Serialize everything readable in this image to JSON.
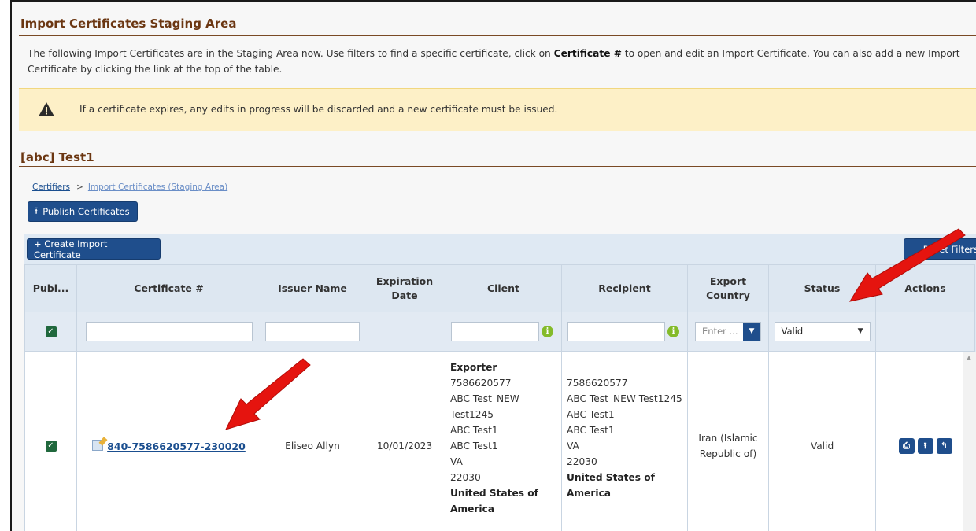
{
  "page": {
    "title": "Import Certificates Staging Area",
    "intro_part1": "The following Import Certificates are in the Staging Area now. Use filters to find a specific certificate, click on ",
    "intro_bold": "Certificate #",
    "intro_part2": " to open and edit an Import Certificate. You can also add a new Import Certificate by clicking the link at the top of the table.",
    "alert": "If a certificate expires, any edits in progress will be discarded and a new certificate must be issued.",
    "section_title": "[abc] Test1"
  },
  "breadcrumb": {
    "root": "Certifiers",
    "separator": ">",
    "current": "Import Certificates (Staging Area)"
  },
  "toolbar": {
    "publish_label": "Publish Certificates",
    "create_label": "+ Create Import Certificate",
    "reset_label": "Reset Filters"
  },
  "table": {
    "headers": {
      "published": "Publ...",
      "certificate": "Certificate #",
      "issuer": "Issuer Name",
      "expiration": "Expiration Date",
      "client": "Client",
      "recipient": "Recipient",
      "export_country": "Export Country",
      "status": "Status",
      "actions": "Actions"
    },
    "filters": {
      "export_country_placeholder": "Enter ...",
      "status_value": "Valid"
    },
    "row": {
      "certificate_number": "840-7586620577-230020",
      "issuer": "Eliseo Allyn",
      "expiration": "10/01/2023",
      "client": {
        "role": "Exporter",
        "line1": "7586620577",
        "line2": "ABC Test_NEW",
        "line3": "Test1245",
        "line4": "ABC Test1",
        "line5": "ABC Test1",
        "line6": "VA",
        "line7": "22030",
        "country": "United States of America"
      },
      "recipient": {
        "line1": "7586620577",
        "line2": "ABC Test_NEW Test1245",
        "line3": "ABC Test1",
        "line4": "ABC Test1",
        "line5": "VA",
        "line6": "22030",
        "country": "United States of America"
      },
      "export_country": "Iran (Islamic Republic of)",
      "status": "Valid"
    }
  },
  "icons": {
    "alert": "warning-icon",
    "publish": "upload-icon",
    "actions": [
      "pdf-icon",
      "upload-icon",
      "return-icon"
    ],
    "filter_info": "info-icon",
    "certificate_edit": "edit-document-icon"
  },
  "colors": {
    "title": "#6b3611",
    "primary_button": "#1f4e8c",
    "checkbox": "#20683d",
    "info": "#84bb2a",
    "alert_bg": "#fdf0c7",
    "annotation_arrow": "#e5140f"
  }
}
